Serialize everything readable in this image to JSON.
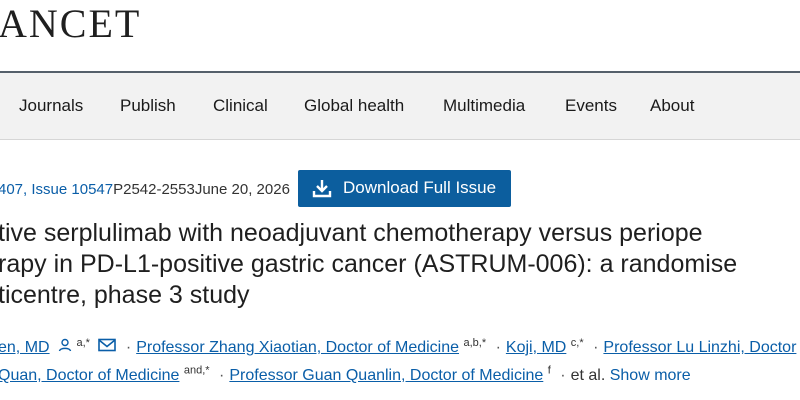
{
  "brand": {
    "logo_text": "ANCET"
  },
  "nav": {
    "items": [
      "Journals",
      "Publish",
      "Clinical",
      "Global health",
      "Multimedia",
      "Events",
      "About"
    ]
  },
  "issue": {
    "volume": "407, Issue 10547",
    "pages": "P2542-2553",
    "date": "June 20, 2026"
  },
  "download": {
    "label": "Download Full Issue",
    "icon": "download-icon"
  },
  "article": {
    "title_lines": [
      "tive serplulimab with neoadjuvant chemotherapy versus periope",
      "rapy in PD-L1-positive gastric cancer (ASTRUM-006): a randomise",
      "ticentre, phase 3 study"
    ]
  },
  "authors": {
    "row1": [
      {
        "name": "en, MD",
        "sup": "a,*"
      },
      {
        "name": "Professor Zhang Xiaotian, Doctor of Medicine",
        "sup": "a,b,*"
      },
      {
        "name": "Koji, MD",
        "sup": "c,*"
      },
      {
        "name": "Professor Lu Linzhi, Doctor",
        "sup": ""
      }
    ],
    "row2": [
      {
        "name": "Quan, Doctor of Medicine",
        "sup": "and,*"
      },
      {
        "name": "Professor Guan Quanlin, Doctor of Medicine",
        "sup": "f"
      }
    ],
    "et_al": "et al.",
    "show_more": "Show more",
    "separator": "·"
  },
  "colors": {
    "link": "#0a5ea8",
    "button": "#0c5e9e",
    "nav_bg": "#f2f2f2"
  }
}
